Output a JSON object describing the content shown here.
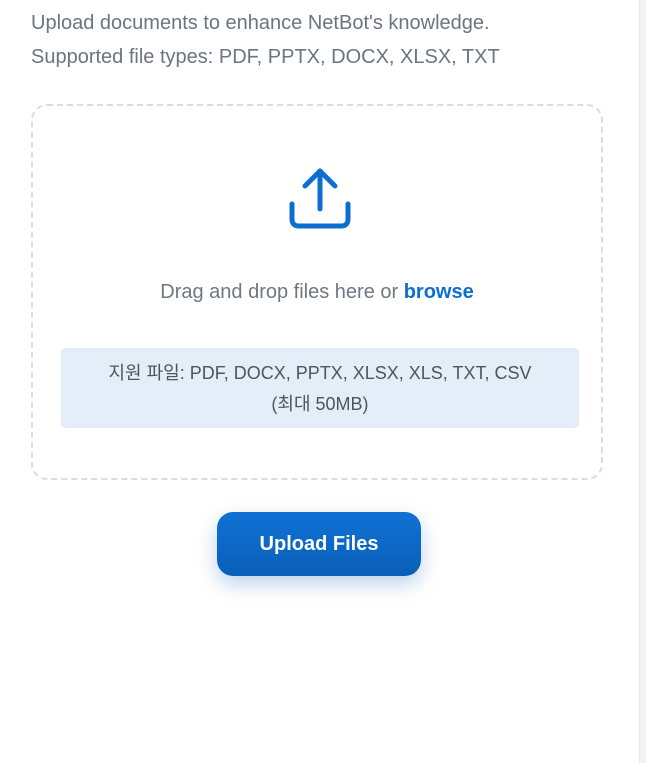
{
  "intro": {
    "line1": "Upload documents to enhance NetBot's knowledge.",
    "line2": "Supported file types: PDF, PPTX, DOCX, XLSX, TXT"
  },
  "dropzone": {
    "icon": "upload-icon",
    "drag_text": "Drag and drop files here or ",
    "browse_label": "browse",
    "supported_line1": "지원 파일: PDF, DOCX, PPTX, XLSX, XLS, TXT, CSV",
    "supported_line2": "(최대 50MB)"
  },
  "actions": {
    "upload_label": "Upload Files"
  },
  "colors": {
    "accent": "#0b6fd1",
    "text_muted": "#6f7782",
    "info_bg": "#e4edf8"
  }
}
